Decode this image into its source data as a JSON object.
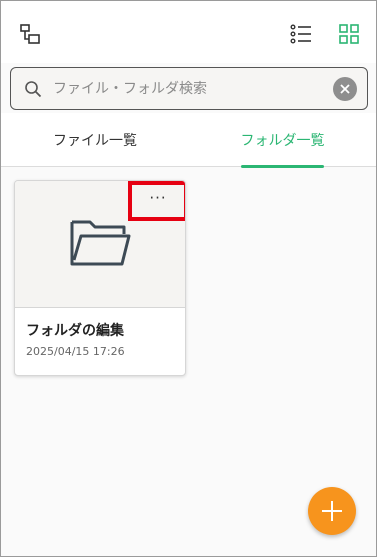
{
  "toolbar": {
    "folder_tree_icon": "folder-tree-icon",
    "list_view_icon": "list-view-icon",
    "grid_view_icon": "grid-view-icon"
  },
  "search": {
    "placeholder": "ファイル・フォルダ検索",
    "value": ""
  },
  "tabs": [
    {
      "label": "ファイル一覧",
      "active": false
    },
    {
      "label": "フォルダ一覧",
      "active": true
    }
  ],
  "folders": [
    {
      "name": "フォルダの編集",
      "date": "2025/04/15 17:26",
      "more_label": "···"
    }
  ],
  "colors": {
    "accent_green": "#2bb673",
    "fab_orange": "#f7941d",
    "highlight_red": "#e60012"
  }
}
